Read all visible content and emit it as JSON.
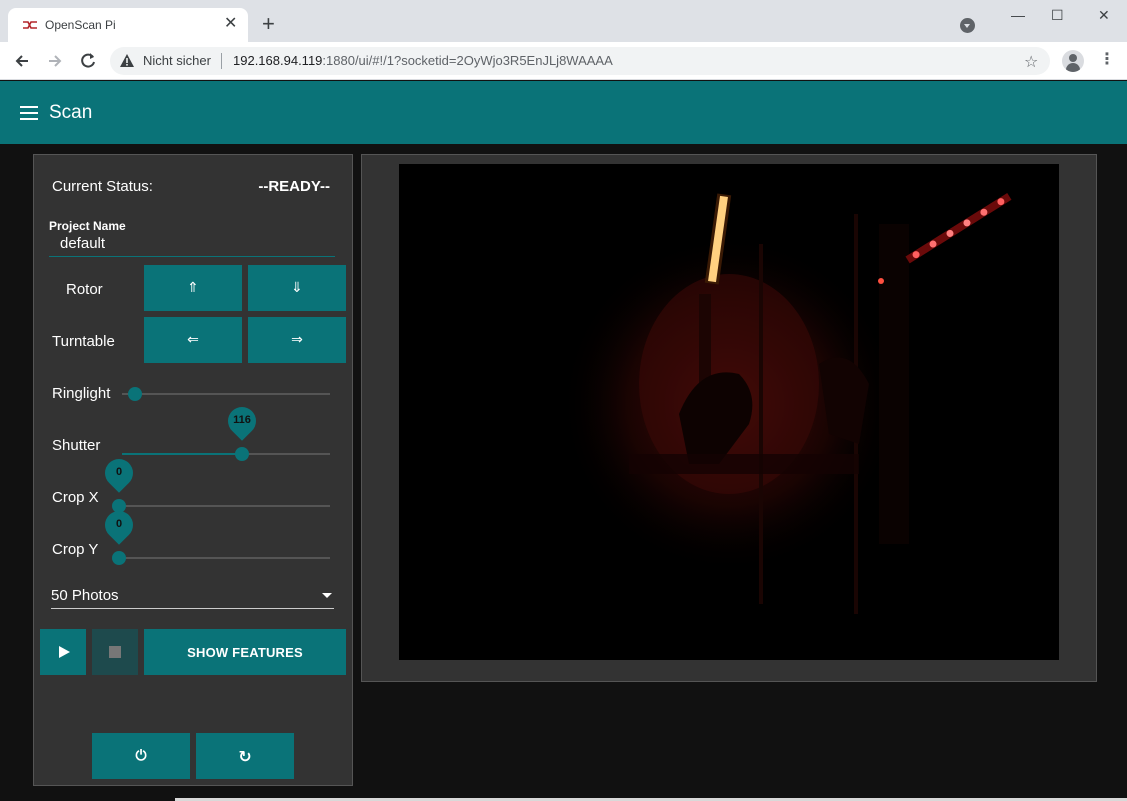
{
  "browser": {
    "tab_title": "OpenScan Pi",
    "tab_close": "✕",
    "new_tab": "+",
    "win_min": "—",
    "win_max": "☐",
    "win_close": "✕",
    "insecure_label": "Nicht sicher",
    "url_host": "192.168.94.119",
    "url_rest": ":1880/ui/#!/1?socketid=2OyWjo3R5EnJLj8WAAAA",
    "menu_dots": "⋮",
    "star": "☆"
  },
  "header": {
    "title": "Scan"
  },
  "panel": {
    "status_label": "Current Status:",
    "status_value": "--READY--",
    "project_label": "Project Name",
    "project_value": "default",
    "rotor_label": "Rotor",
    "rotor_up": "⇑",
    "rotor_down": "⇓",
    "turntable_label": "Turntable",
    "turntable_left": "⇐",
    "turntable_right": "⇒",
    "ringlight_label": "Ringlight",
    "ringlight_value": 0,
    "shutter_label": "Shutter",
    "shutter_value": "116",
    "shutter_fraction": 0.58,
    "cropx_label": "Crop X",
    "cropx_value": "0",
    "cropy_label": "Crop Y",
    "cropy_value": "0",
    "photos_selected": "50 Photos",
    "show_features": "SHOW FEATURES",
    "power_icon": "⏻",
    "refresh_icon": "↻"
  },
  "colors": {
    "accent": "#0a7378",
    "panel_bg": "#333333",
    "page_bg": "#111111"
  }
}
